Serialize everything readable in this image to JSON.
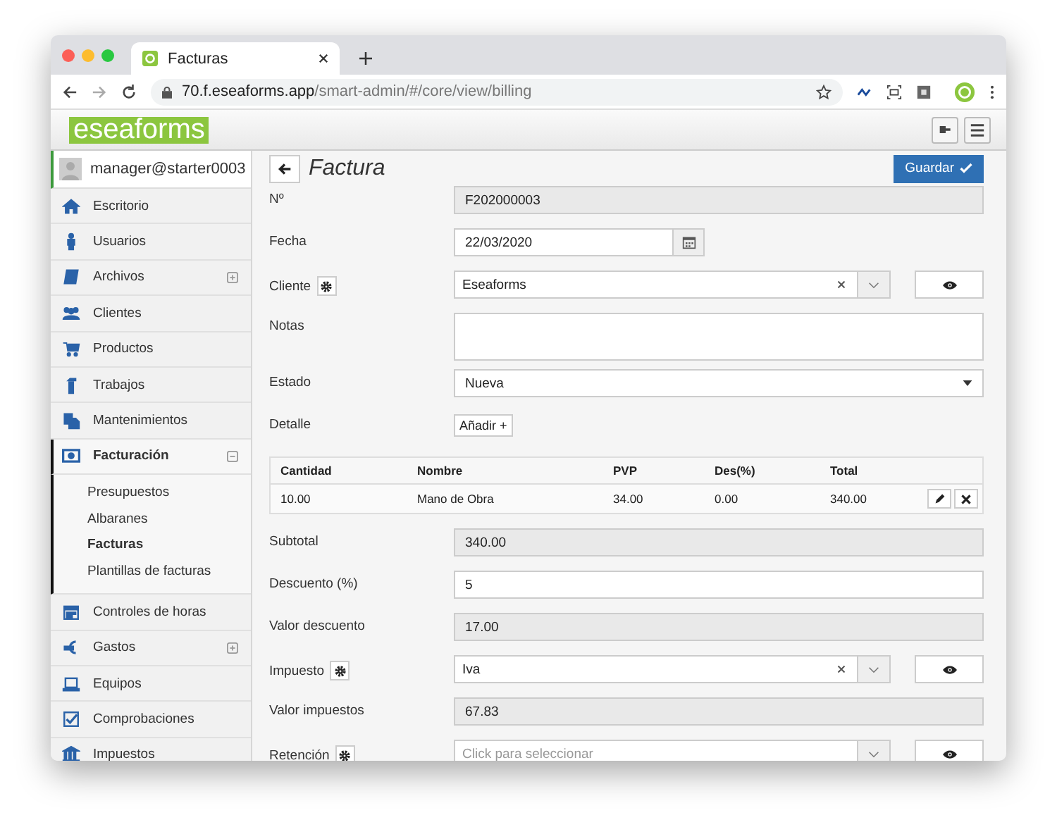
{
  "browser": {
    "tab_title": "Facturas",
    "url_host": "70.f.eseaforms.app",
    "url_path": "/smart-admin/#/core/view/billing"
  },
  "app": {
    "logo": "eseaforms",
    "user": "manager@starter0003"
  },
  "sidebar": {
    "items": [
      {
        "label": "Escritorio"
      },
      {
        "label": "Usuarios"
      },
      {
        "label": "Archivos",
        "expanded": false
      },
      {
        "label": "Clientes"
      },
      {
        "label": "Productos"
      },
      {
        "label": "Trabajos"
      },
      {
        "label": "Mantenimientos"
      },
      {
        "label": "Facturación",
        "expanded": true,
        "children": [
          {
            "label": "Presupuestos",
            "selected": false
          },
          {
            "label": "Albaranes",
            "selected": false
          },
          {
            "label": "Facturas",
            "selected": true
          },
          {
            "label": "Plantillas de facturas",
            "selected": false
          }
        ]
      },
      {
        "label": "Controles de horas"
      },
      {
        "label": "Gastos",
        "expanded": false
      },
      {
        "label": "Equipos"
      },
      {
        "label": "Comprobaciones"
      },
      {
        "label": "Impuestos"
      }
    ]
  },
  "page": {
    "title": "Factura",
    "save_button": "Guardar"
  },
  "fields": [
    {
      "kind": "readonly",
      "label": "Nº",
      "value": "F202000003"
    },
    {
      "kind": "date",
      "label": "Fecha",
      "value": "22/03/2020"
    },
    {
      "kind": "lookup",
      "label": "Cliente",
      "value": "Eseaforms"
    },
    {
      "kind": "textarea",
      "label": "Notas"
    },
    {
      "kind": "dropdown",
      "label": "Estado",
      "value": "Nueva"
    },
    {
      "kind": "add",
      "label": "Detalle",
      "button": "Añadir +"
    },
    {
      "kind": "table",
      "columns": [
        "Cantidad",
        "Nombre",
        "PVP",
        "Des(%)",
        "Total"
      ],
      "rows": [
        [
          "10.00",
          "Mano de Obra",
          "34.00",
          "0.00",
          "340.00"
        ]
      ]
    },
    {
      "kind": "readonly",
      "label": "Subtotal",
      "value": "340.00"
    },
    {
      "kind": "input",
      "label": "Descuento (%)",
      "value": "5"
    },
    {
      "kind": "readonly",
      "label": "Valor descuento",
      "value": "17.00"
    },
    {
      "kind": "lookup",
      "label": "Impuesto",
      "value": "Iva"
    },
    {
      "kind": "readonly",
      "label": "Valor impuestos",
      "value": "67.83"
    },
    {
      "kind": "lookup",
      "label": "Retención",
      "placeholder": "Click para seleccionar"
    }
  ]
}
